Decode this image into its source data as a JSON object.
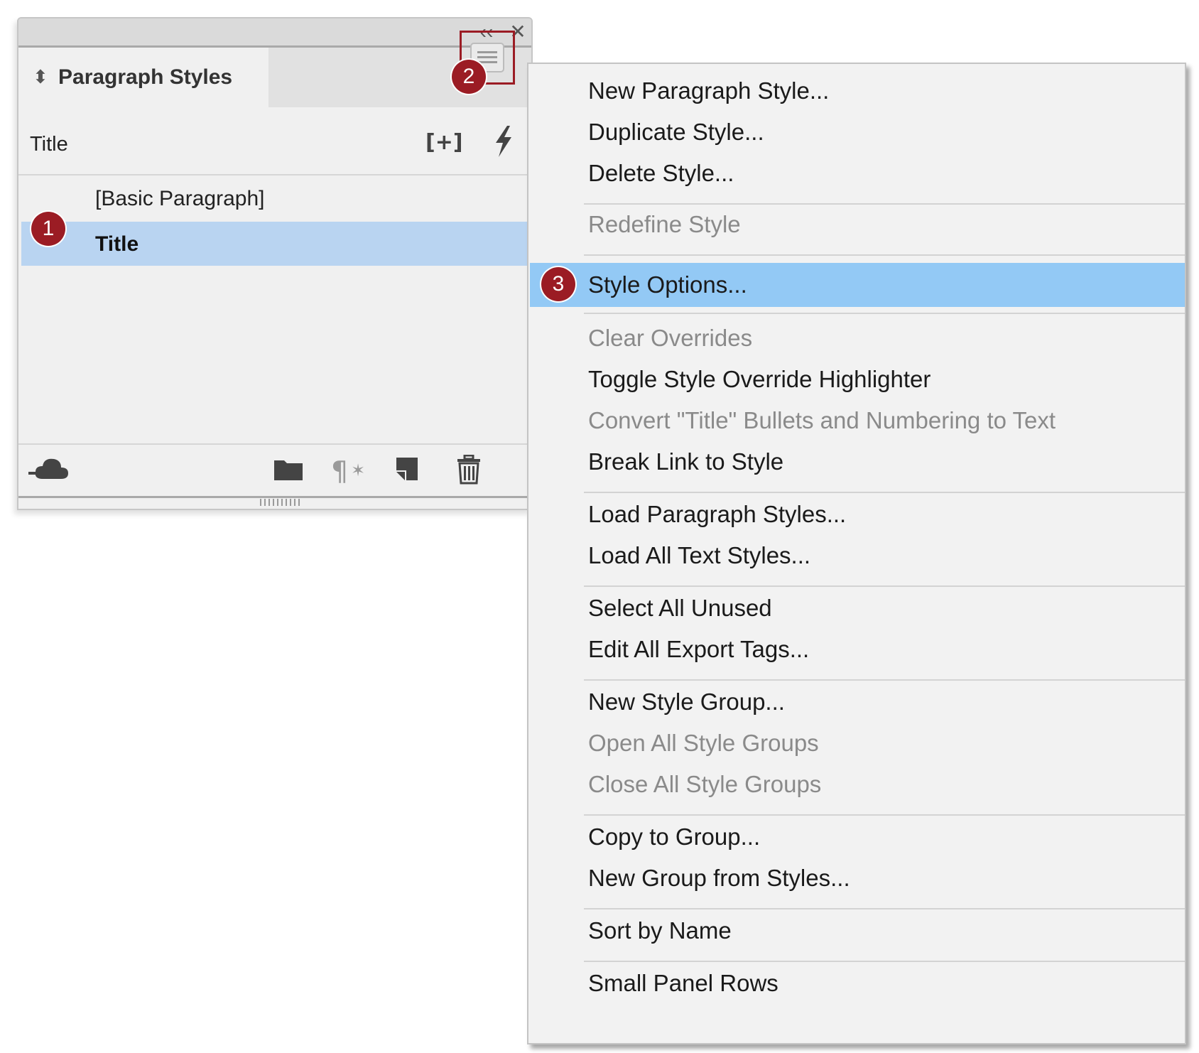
{
  "panel": {
    "collapse_glyph": "‹‹",
    "close_glyph": "✕",
    "tab_chevron": "⬍",
    "tab_title": "Paragraph Styles",
    "current_style": "Title",
    "new_style_glyph": "[+]",
    "styles": [
      {
        "label": "[Basic Paragraph]",
        "selected": false
      },
      {
        "label": "Title",
        "selected": true
      }
    ]
  },
  "badges": {
    "one": "1",
    "two": "2",
    "three": "3"
  },
  "menu": {
    "new_paragraph_style": "New Paragraph Style...",
    "duplicate_style": "Duplicate Style...",
    "delete_style": "Delete Style...",
    "redefine_style": "Redefine Style",
    "style_options": "Style Options...",
    "clear_overrides": "Clear Overrides",
    "toggle_highlighter": "Toggle Style Override Highlighter",
    "convert_bullets": "Convert \"Title\" Bullets and Numbering to Text",
    "break_link": "Break Link to Style",
    "load_paragraph_styles": "Load Paragraph Styles...",
    "load_all_text_styles": "Load All Text Styles...",
    "select_all_unused": "Select All Unused",
    "edit_export_tags": "Edit All Export Tags...",
    "new_style_group": "New Style Group...",
    "open_all_groups": "Open All Style Groups",
    "close_all_groups": "Close All Style Groups",
    "copy_to_group": "Copy to Group...",
    "new_group_from_styles": "New Group from Styles...",
    "sort_by_name": "Sort by Name",
    "small_panel_rows": "Small Panel Rows"
  },
  "colors": {
    "badge": "#9b1c24",
    "selected_row": "#b9d4f1",
    "menu_highlight": "#93c9f5",
    "disabled_text": "#8a8a8a"
  },
  "icons": {
    "collapse": "double-chevron-left-icon",
    "close": "close-icon",
    "panel_menu": "hamburger-menu-icon",
    "new_style_group_plus": "create-style-icon",
    "quick_apply": "lightning-bolt-icon",
    "cc_libraries": "cloud-icon",
    "folder": "folder-icon",
    "clear_override": "pilcrow-clear-icon",
    "new_style": "new-page-icon",
    "delete": "trash-icon"
  }
}
